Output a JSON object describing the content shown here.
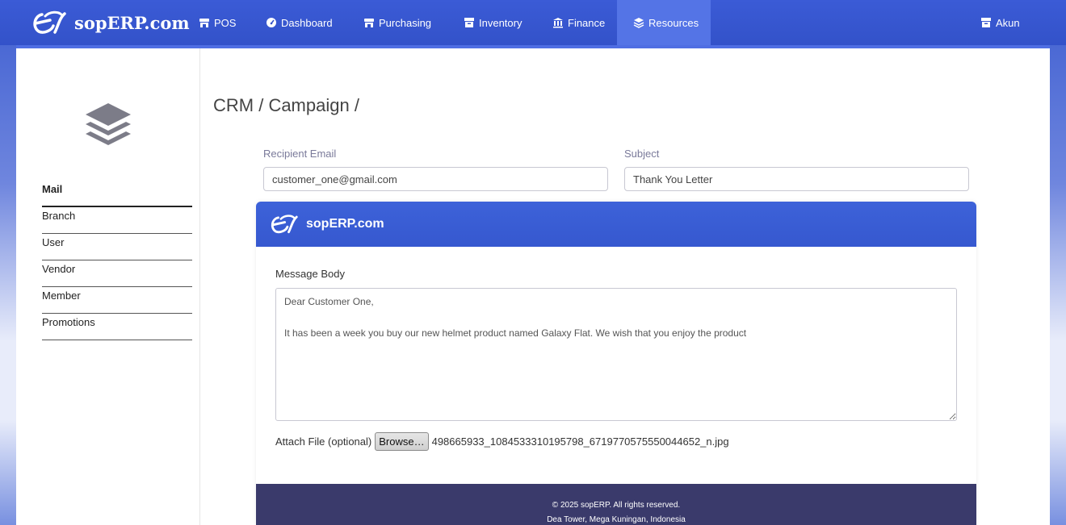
{
  "brand": {
    "name": "sopERP.com"
  },
  "nav": {
    "items": [
      {
        "label": "POS",
        "icon": "store-icon"
      },
      {
        "label": "Dashboard",
        "icon": "gauge-icon"
      },
      {
        "label": "Purchasing",
        "icon": "store-icon"
      },
      {
        "label": "Inventory",
        "icon": "box-icon"
      },
      {
        "label": "Finance",
        "icon": "bank-icon"
      },
      {
        "label": "Resources",
        "icon": "layers-icon",
        "active": true
      }
    ],
    "account": {
      "label": "Akun",
      "icon": "box-icon"
    }
  },
  "sidebar": {
    "icon": "layers-icon",
    "items": [
      {
        "label": "Mail",
        "active": true
      },
      {
        "label": "Branch"
      },
      {
        "label": "User"
      },
      {
        "label": "Vendor"
      },
      {
        "label": "Member"
      },
      {
        "label": "Promotions"
      }
    ]
  },
  "breadcrumb": "CRM / Campaign /",
  "form": {
    "recipient_label": "Recipient Email",
    "recipient_value": "customer_one@gmail.com",
    "subject_label": "Subject",
    "subject_value": "Thank You Letter"
  },
  "mail": {
    "header_title": "sopERP.com",
    "body_label": "Message Body",
    "body_text": "Dear Customer One,\n\nIt has been a week you buy our new helmet product named Galaxy Flat. We wish that you enjoy the product",
    "attach_label": "Attach File (optional)",
    "browse_label": "Browse…",
    "attach_filename": "498665933_1084533310195798_6719770575550044652_n.jpg",
    "footer_line1": "© 2025 sopERP. All rights reserved.",
    "footer_line2": "Dea Tower, Mega Kuningan, Indonesia"
  },
  "colors": {
    "primary": "#3b5bd6",
    "active_nav": "#5474e6",
    "footer": "#3a3a6b"
  }
}
